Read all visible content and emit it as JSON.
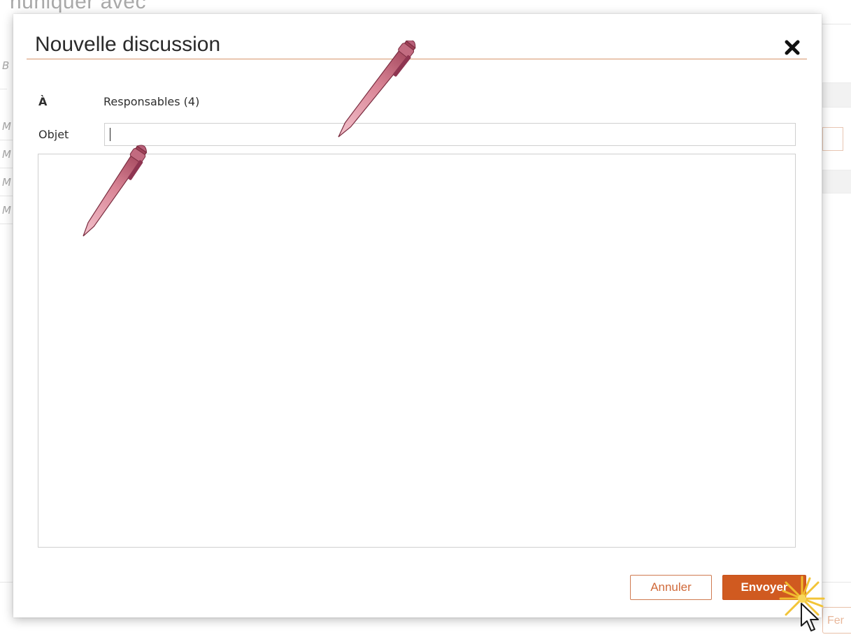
{
  "background": {
    "heading_fragment": "nuniquer avec",
    "row_letters": [
      "M",
      "M",
      "M",
      "M"
    ],
    "side_letter": "B",
    "close_button_fragment": "Fer"
  },
  "dialog": {
    "title": "Nouvelle discussion",
    "close_icon": "close-icon",
    "to_label": "À",
    "to_value": "Responsables (4)",
    "subject_label": "Objet",
    "subject_value": "",
    "body_value": "",
    "cancel_label": "Annuler",
    "send_label": "Envoyer"
  },
  "colors": {
    "accent": "#d05a20",
    "title_rule": "#d6946a",
    "cancel_border": "#cf7a50",
    "annotation_pen": "#d98596",
    "cursor_highlight": "#f2c12e"
  },
  "annotations": {
    "pen_icon": "pen-icon",
    "cursor_icon": "mouse-pointer-icon"
  }
}
